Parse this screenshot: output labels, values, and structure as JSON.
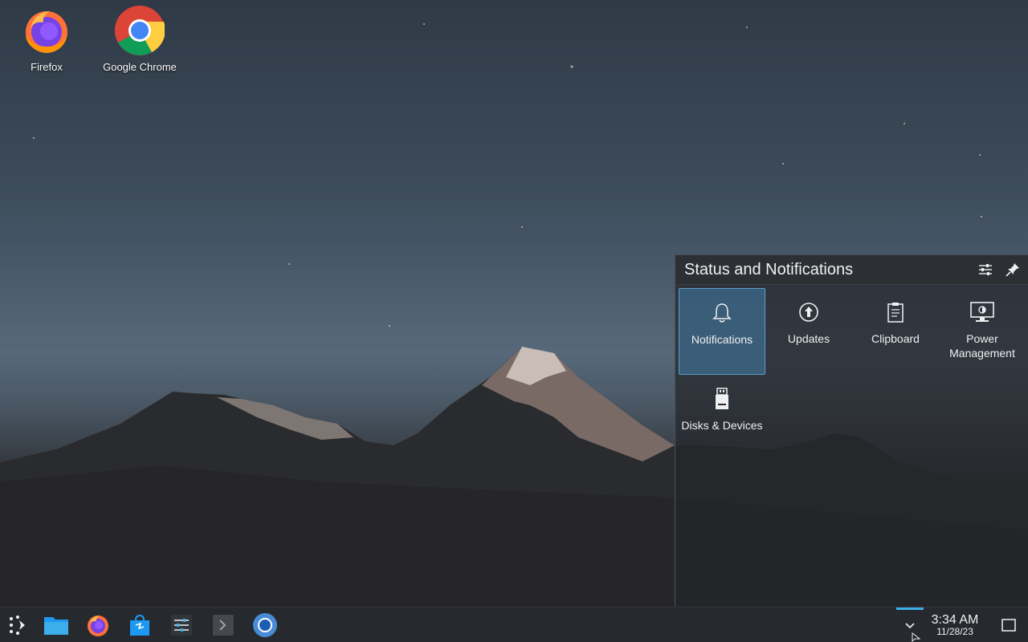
{
  "desktop": {
    "icons": [
      {
        "label": "Firefox",
        "icon": "firefox-icon"
      },
      {
        "label": "Google Chrome",
        "icon": "chrome-icon"
      }
    ]
  },
  "popup": {
    "title": "Status and Notifications",
    "header_buttons": [
      "configure-icon",
      "pin-icon"
    ],
    "items": [
      {
        "label": "Notifications",
        "icon": "bell-icon",
        "active": true
      },
      {
        "label": "Updates",
        "icon": "update-icon",
        "active": false
      },
      {
        "label": "Clipboard",
        "icon": "clipboard-icon",
        "active": false
      },
      {
        "label": "Power Management",
        "icon": "power-management-icon",
        "active": false
      },
      {
        "label": "Disks & Devices",
        "icon": "usb-drive-icon",
        "active": false
      }
    ]
  },
  "taskbar": {
    "items": [
      "app-launcher-icon",
      "file-manager-icon",
      "firefox-icon",
      "discover-store-icon",
      "system-settings-icon",
      "terminal-icon",
      "chromium-icon"
    ],
    "tray_expand_icon": "chevron-down-icon",
    "clock": {
      "time": "3:34 AM",
      "date": "11/28/23"
    },
    "show_desktop_icon": "show-desktop-icon"
  },
  "colors": {
    "accent": "#3daee9",
    "panel": "#262a2f",
    "active_item": "#3d6b8c"
  }
}
